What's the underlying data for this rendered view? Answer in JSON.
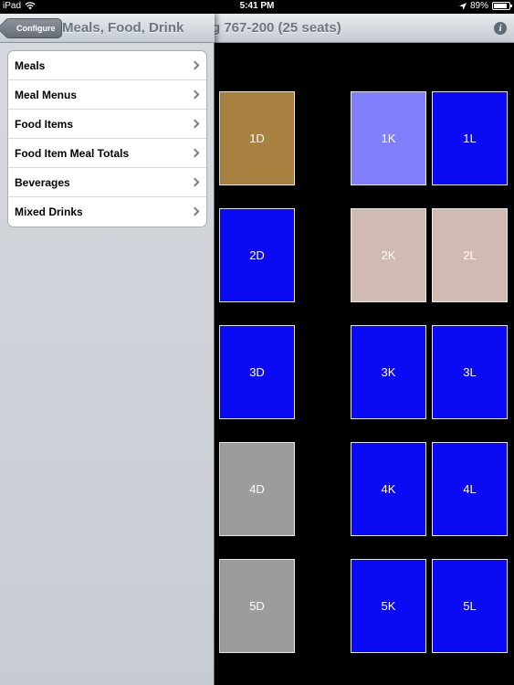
{
  "status_bar": {
    "device": "iPad",
    "time": "5:41 PM",
    "battery": "89%",
    "battery_level": 0.89
  },
  "main": {
    "title": "g 767-200 (25 seats)"
  },
  "panel": {
    "back_label": "Configure",
    "title": "Meals, Food, Drink",
    "items": [
      {
        "label": "Meals"
      },
      {
        "label": "Meal Menus"
      },
      {
        "label": "Food Items"
      },
      {
        "label": "Food Item Meal Totals"
      },
      {
        "label": "Beverages"
      },
      {
        "label": "Mixed Drinks"
      }
    ]
  },
  "colors": {
    "blue": "#0a0af5",
    "lavender": "#7f7ffc",
    "tan": "#d1bab1",
    "brown": "#a8803f",
    "gray": "#9c9c9c"
  },
  "seats": [
    {
      "label": "1D",
      "color": "brown"
    },
    {
      "label": "2D",
      "color": "blue"
    },
    {
      "label": "3D",
      "color": "blue"
    },
    {
      "label": "4D",
      "color": "gray"
    },
    {
      "label": "5D",
      "color": "gray"
    },
    {
      "label": "1K",
      "color": "lavender"
    },
    {
      "label": "1L",
      "color": "blue"
    },
    {
      "label": "2K",
      "color": "tan"
    },
    {
      "label": "2L",
      "color": "tan"
    },
    {
      "label": "3K",
      "color": "blue"
    },
    {
      "label": "3L",
      "color": "blue"
    },
    {
      "label": "4K",
      "color": "blue"
    },
    {
      "label": "4L",
      "color": "blue"
    },
    {
      "label": "5K",
      "color": "blue"
    },
    {
      "label": "5L",
      "color": "blue"
    }
  ]
}
